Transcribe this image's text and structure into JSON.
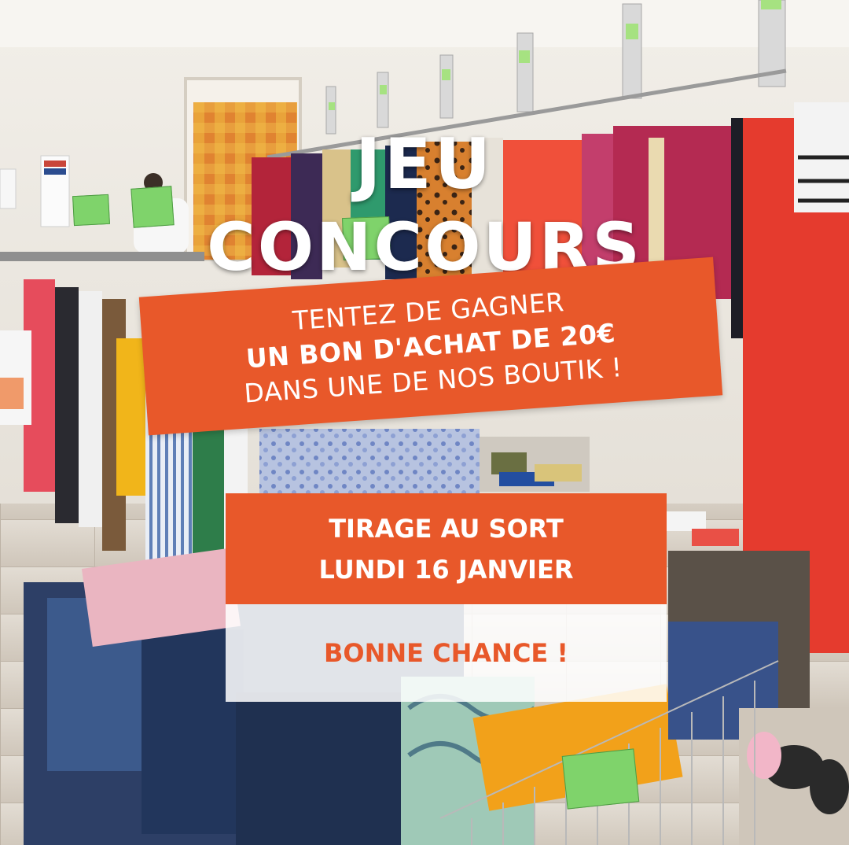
{
  "headline": {
    "line1": "JEU",
    "line2": "CONCOURS"
  },
  "banner": {
    "line1": "TENTEZ DE GAGNER",
    "line2": "UN BON D'ACHAT DE 20€",
    "line3": "DANS UNE DE NOS BOUTIK !"
  },
  "draw": {
    "line1": "TIRAGE AU SORT",
    "line2": "LUNDI 16 JANVIER"
  },
  "closing": {
    "text": "BONNE CHANCE !"
  },
  "colors": {
    "accent": "#e8582a",
    "text_light": "#ffffff",
    "panel_light": "#ffffff"
  }
}
